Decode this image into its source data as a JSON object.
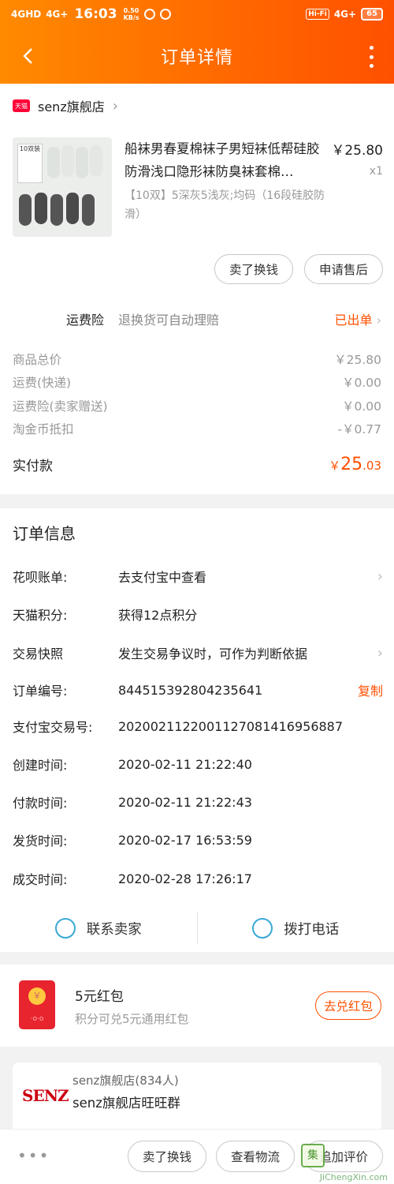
{
  "status_bar": {
    "network_left": "4GHD",
    "network_left2": "4G+",
    "time": "16:03",
    "speed_value": "0.50",
    "speed_unit": "KB/s",
    "hifi": "Hi-Fi",
    "network_right": "4G+",
    "battery": "65"
  },
  "header": {
    "title": "订单详情"
  },
  "shop": {
    "badge": "天猫",
    "name": "senz旗舰店"
  },
  "product": {
    "title": "船袜男春夏棉袜子男短袜低帮硅胶防滑浅口隐形袜防臭袜套棉…",
    "sku": "【10双】5深灰5浅灰;均码（16段硅胶防滑）",
    "price": "￥25.80",
    "qty": "x1",
    "thumb_label": "10双装"
  },
  "product_actions": {
    "sell": "卖了换钱",
    "after_sale": "申请售后"
  },
  "insurance": {
    "label": "运费险",
    "desc": "退换货可自动理赔",
    "status": "已出单"
  },
  "costs": [
    {
      "label": "商品总价",
      "value": "￥25.80"
    },
    {
      "label": "运费(快递)",
      "value": "￥0.00"
    },
    {
      "label": "运费险(卖家赠送)",
      "value": "￥0.00"
    },
    {
      "label": "淘金币抵扣",
      "value": "-￥0.77"
    }
  ],
  "total": {
    "label": "实付款",
    "currency": "￥",
    "int": "25",
    "dec": ".03"
  },
  "order_info": {
    "title": "订单信息",
    "rows": [
      {
        "key": "花呗账单:",
        "value": "去支付宝中查看"
      },
      {
        "key": "天猫积分:",
        "value": "获得12点积分"
      },
      {
        "key": "交易快照",
        "value": "发生交易争议时，可作为判断依据"
      },
      {
        "key": "订单编号:",
        "value": "844515392804235641"
      },
      {
        "key": "支付宝交易号:",
        "value": "2020021122001127081416956887"
      },
      {
        "key": "创建时间:",
        "value": "2020-02-11 21:22:40"
      },
      {
        "key": "付款时间:",
        "value": "2020-02-11 21:22:43"
      },
      {
        "key": "发货时间:",
        "value": "2020-02-17 16:53:59"
      },
      {
        "key": "成交时间:",
        "value": "2020-02-28 17:26:17"
      }
    ],
    "copy_label": "复制"
  },
  "contact": {
    "seller": "联系卖家",
    "phone": "拨打电话"
  },
  "redpack": {
    "title": "5元红包",
    "subtitle": "积分可兑5元通用红包",
    "button": "去兑红包",
    "coin": "￥"
  },
  "group": {
    "logo": "SENZ",
    "name": "senz旗舰店(834人)",
    "title": "senz旗舰店旺旺群"
  },
  "bottom_bar": {
    "sell": "卖了换钱",
    "logistics": "查看物流",
    "review": "追加评价"
  },
  "watermark": "JiChengXin.com"
}
